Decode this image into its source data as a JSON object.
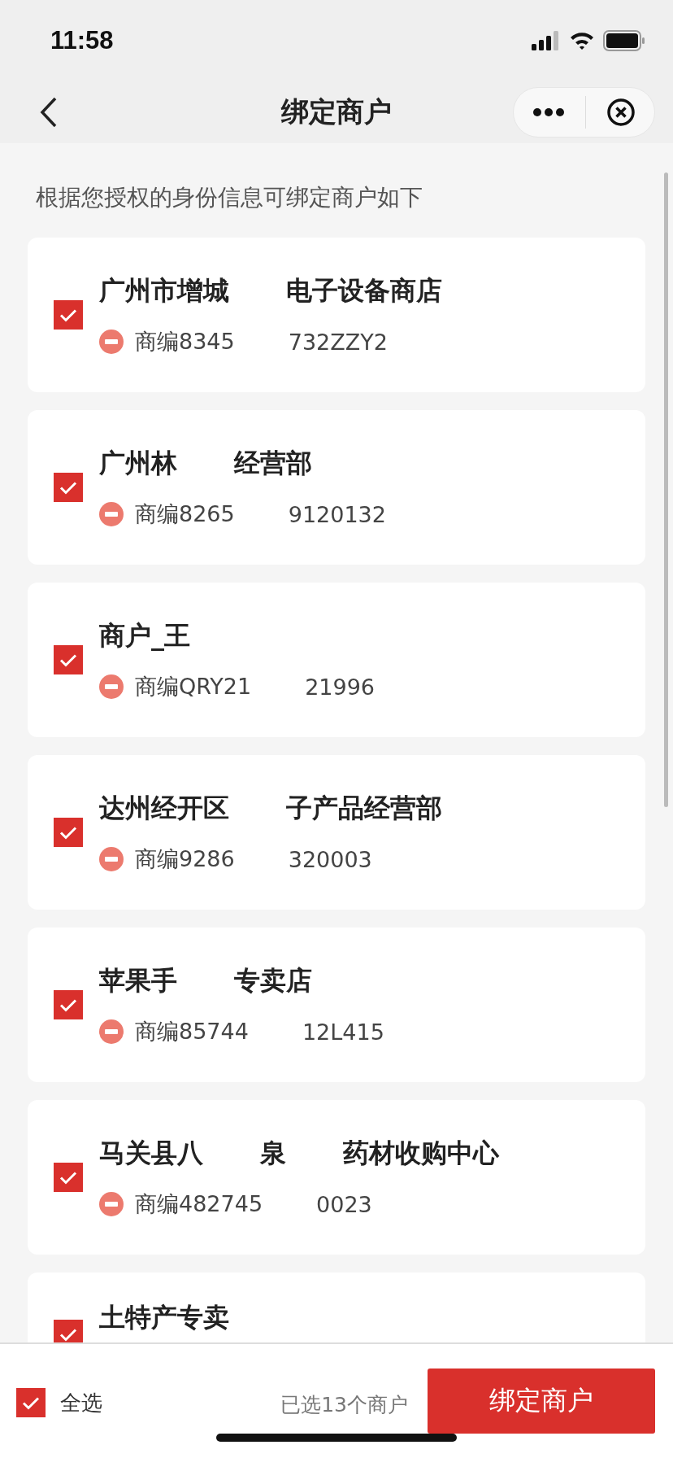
{
  "status_bar": {
    "time": "11:58"
  },
  "nav": {
    "title": "绑定商户"
  },
  "intro": "根据您授权的身份信息可绑定商户如下",
  "merchants": [
    {
      "name_parts": [
        "广州市增城",
        "电子设备商店"
      ],
      "code_parts": [
        "商编8345",
        "732ZZY2"
      ],
      "checked": true
    },
    {
      "name_parts": [
        "广州林",
        "经营部"
      ],
      "code_parts": [
        "商编8265",
        "9120132"
      ],
      "checked": true
    },
    {
      "name_parts": [
        "商户_王"
      ],
      "code_parts": [
        "商编QRY21",
        "21996"
      ],
      "checked": true
    },
    {
      "name_parts": [
        "达州经开区",
        "子产品经营部"
      ],
      "code_parts": [
        "商编9286",
        "320003"
      ],
      "checked": true
    },
    {
      "name_parts": [
        "苹果手",
        "专卖店"
      ],
      "code_parts": [
        "商编85744",
        "12L415"
      ],
      "checked": true
    },
    {
      "name_parts": [
        "马关县八",
        "泉",
        "药材收购中心"
      ],
      "code_parts": [
        "商编482745",
        "0023"
      ],
      "checked": true
    },
    {
      "name_parts": [
        "土特产专卖"
      ],
      "checked": true
    }
  ],
  "footer": {
    "select_all": {
      "label": "全选",
      "checked": true
    },
    "count": "已选13个商户",
    "button": "绑定商户"
  }
}
